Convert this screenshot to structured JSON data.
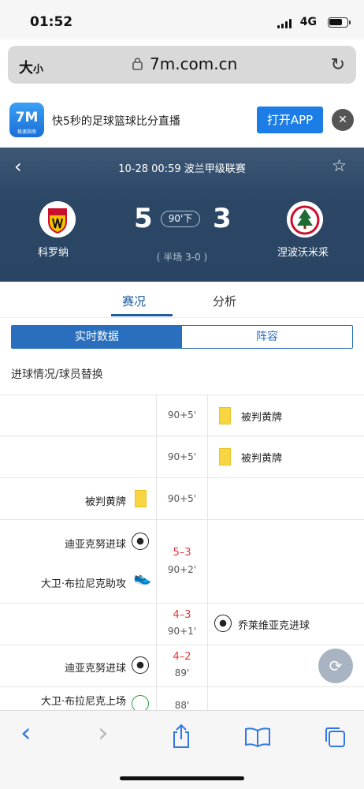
{
  "status": {
    "time": "01:52",
    "network": "4G"
  },
  "browser": {
    "text_size": "大",
    "text_size_small": "小",
    "url": "7m.com.cn"
  },
  "appbanner": {
    "logo": "7M",
    "logo_sub": "极速指南",
    "text": "快5秒的足球篮球比分直播",
    "open_label": "打开APP",
    "close": "✕"
  },
  "match": {
    "info": "10-28 00:59 波兰甲级联赛",
    "home": "科罗纳",
    "away": "涅波沃米采",
    "home_score": "5",
    "away_score": "3",
    "minute": "90'下",
    "halftime": "( 半场 3-0 )"
  },
  "tabs": {
    "live": "赛况",
    "analysis": "分析"
  },
  "segment": {
    "realtime": "实时数据",
    "lineup": "阵容"
  },
  "section_title": "进球情况/球员替换",
  "events": [
    {
      "time": "90+5'",
      "side": "away",
      "text": "被判黄牌"
    },
    {
      "time": "90+5'",
      "side": "away",
      "text": "被判黄牌"
    },
    {
      "time": "90+5'",
      "side": "home",
      "text": "被判黄牌"
    },
    {
      "time": "90+2'",
      "score": "5–3",
      "side": "home",
      "text": "迪亚克努进球",
      "assist": "大卫·布拉尼克助攻"
    },
    {
      "time": "90+1'",
      "score": "4–3",
      "side": "away",
      "text": "乔莱维亚克进球"
    },
    {
      "time": "89'",
      "score": "4–2",
      "side": "home",
      "text": "迪亚克努进球"
    },
    {
      "time": "88'",
      "side": "home",
      "text": "大卫·布拉尼克上场"
    }
  ],
  "toolbar": {
    "back": "‹",
    "forward": "›"
  }
}
